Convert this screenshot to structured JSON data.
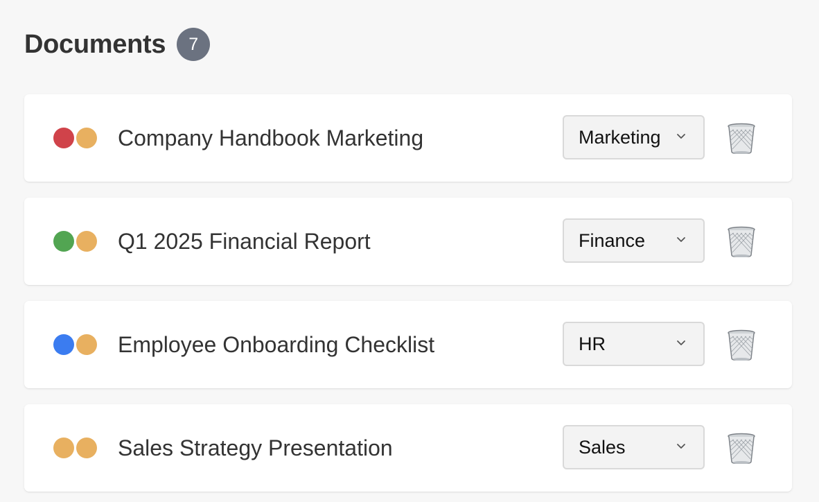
{
  "header": {
    "title": "Documents",
    "count": "7"
  },
  "documents": [
    {
      "title": "Company Handbook Marketing",
      "department": "Marketing",
      "status_colors": [
        "#d0434a",
        "#e8b060"
      ]
    },
    {
      "title": "Q1 2025 Financial Report",
      "department": "Finance",
      "status_colors": [
        "#52a552",
        "#e8b060"
      ]
    },
    {
      "title": "Employee Onboarding Checklist",
      "department": "HR",
      "status_colors": [
        "#3b7cf0",
        "#e8b060"
      ]
    },
    {
      "title": "Sales Strategy Presentation",
      "department": "Sales",
      "status_colors": [
        "#e8b060",
        "#e8b060"
      ]
    }
  ],
  "icons": {
    "select_arrow": "chevron-down-icon",
    "delete": "trash-icon"
  },
  "colors": {
    "badge_bg": "#6b7280",
    "page_bg": "#f7f7f7",
    "card_bg": "#ffffff"
  }
}
